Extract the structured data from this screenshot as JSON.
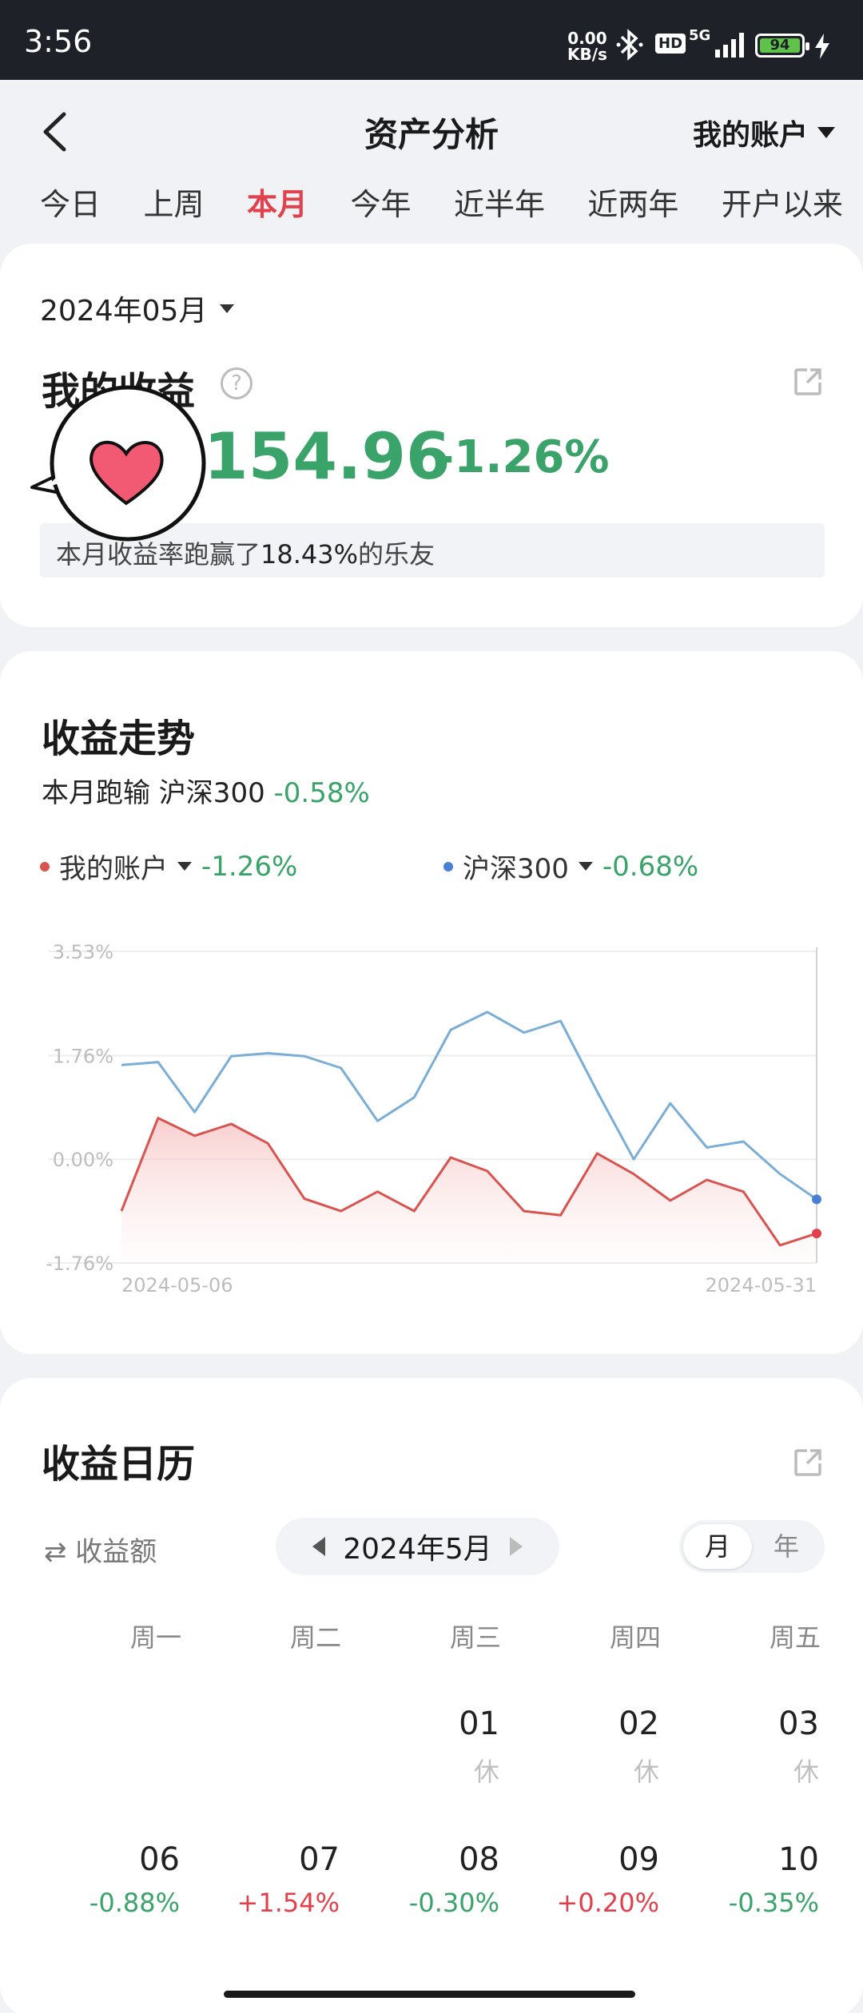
{
  "status_bar": {
    "time": "3:56",
    "net_speed": "0.00",
    "net_unit": "KB/s",
    "hd": "HD",
    "signal": "5G",
    "battery": "94"
  },
  "header": {
    "title": "资产分析",
    "account": "我的账户"
  },
  "tabs": [
    {
      "label": "今日",
      "active": false
    },
    {
      "label": "上周",
      "active": false
    },
    {
      "label": "本月",
      "active": true
    },
    {
      "label": "今年",
      "active": false
    },
    {
      "label": "近半年",
      "active": false
    },
    {
      "label": "近两年",
      "active": false
    },
    {
      "label": "开户以来",
      "active": false
    }
  ],
  "summary": {
    "month": "2024年05月",
    "title": "我的收益",
    "amount": "154.96",
    "pct": "-1.26%",
    "beat_prefix": "本月收益率跑赢了",
    "beat_value": "18.43%",
    "beat_suffix": "的乐友"
  },
  "trend": {
    "title": "收益走势",
    "compare_text": "本月跑输 沪深300",
    "compare_pct": "-0.58%",
    "legend_account": "我的账户",
    "legend_account_pct": "-1.26%",
    "legend_index": "沪深300",
    "legend_index_pct": "-0.68%"
  },
  "chart_data": {
    "type": "line",
    "x_start_label": "2024-05-06",
    "x_end_label": "2024-05-31",
    "y_ticks": [
      "3.53%",
      "1.76%",
      "0.00%",
      "-1.76%"
    ],
    "ylim": [
      -1.76,
      3.53
    ],
    "series": [
      {
        "name": "我的账户",
        "color": "#d9534f",
        "values": [
          -0.88,
          0.7,
          0.4,
          0.6,
          0.27,
          -0.67,
          -0.88,
          -0.55,
          -0.88,
          0.03,
          -0.2,
          -0.88,
          -0.95,
          0.1,
          -0.25,
          -0.7,
          -0.35,
          -0.55,
          -1.46,
          -1.26
        ]
      },
      {
        "name": "沪深300",
        "color": "#7aaed6",
        "values": [
          1.6,
          1.65,
          0.8,
          1.75,
          1.8,
          1.75,
          1.55,
          0.65,
          1.05,
          2.2,
          2.5,
          2.15,
          2.35,
          1.15,
          0.0,
          0.95,
          0.2,
          0.3,
          -0.25,
          -0.68
        ]
      }
    ]
  },
  "calendar": {
    "title": "收益日历",
    "metric_toggle": "⇄ 收益额",
    "month": "2024年5月",
    "view_month": "月",
    "view_year": "年",
    "weekdays": [
      "周一",
      "周二",
      "周三",
      "周四",
      "周五"
    ],
    "row1": [
      {
        "day": "01",
        "value": "休"
      },
      {
        "day": "02",
        "value": "休"
      },
      {
        "day": "03",
        "value": "休"
      }
    ],
    "row2": [
      {
        "day": "06",
        "value": "-0.88%"
      },
      {
        "day": "07",
        "value": "+1.54%"
      },
      {
        "day": "08",
        "value": "-0.30%"
      },
      {
        "day": "09",
        "value": "+0.20%"
      },
      {
        "day": "10",
        "value": "-0.35%"
      }
    ]
  }
}
